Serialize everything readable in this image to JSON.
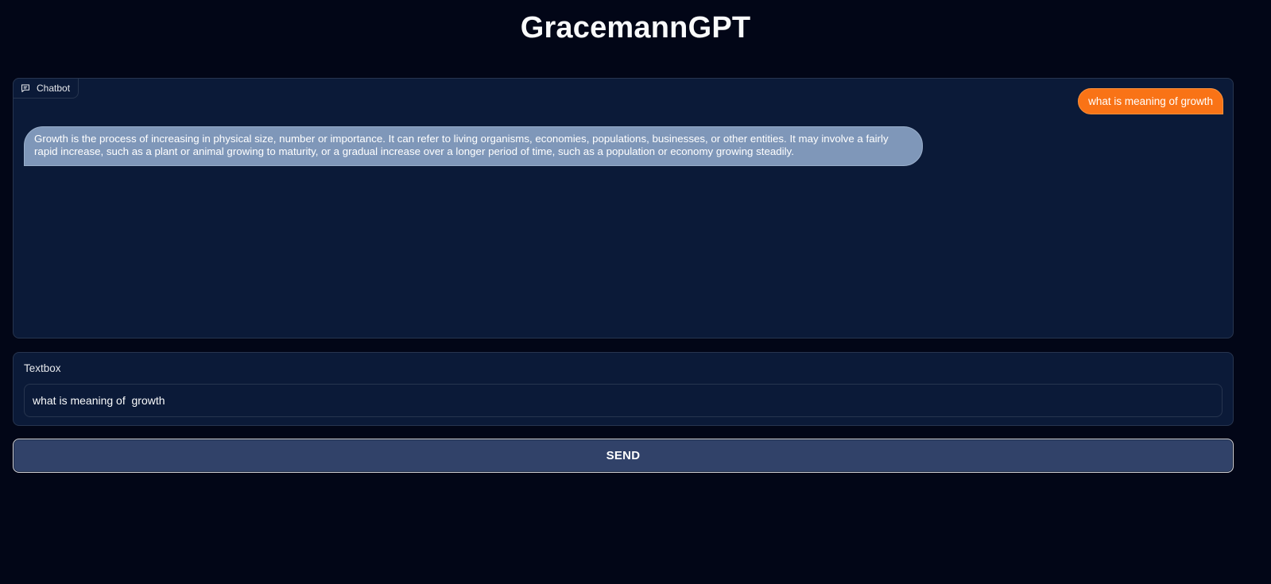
{
  "app": {
    "title": "GracemannGPT"
  },
  "chatbot": {
    "label": "Chatbot",
    "icon": "chat-bubble-icon",
    "messages": [
      {
        "role": "user",
        "text": "what is meaning of growth"
      },
      {
        "role": "bot",
        "text": "Growth is the process of increasing in physical size, number or importance. It can refer to living organisms, economies, populations, businesses, or other entities. It may involve a fairly rapid increase, such as a plant or animal growing to maturity, or a gradual increase over a longer period of time, such as a population or economy growing steadily."
      }
    ]
  },
  "textbox": {
    "label": "Textbox",
    "value": "what is meaning of  growth"
  },
  "send_button": {
    "label": "SEND"
  },
  "colors": {
    "background": "#020617",
    "panel": "#0b1a38",
    "user_bubble": "#f97316",
    "bot_bubble": "#7f97b9",
    "button": "#314269"
  }
}
